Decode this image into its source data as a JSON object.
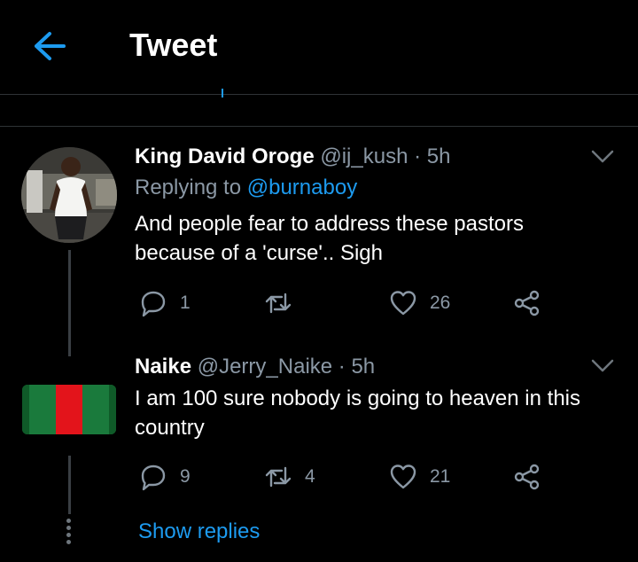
{
  "header": {
    "title": "Tweet"
  },
  "tweets": [
    {
      "name": "King David Oroge",
      "handle": "@ij_kush",
      "time": "· 5h",
      "replying_prefix": "Replying to",
      "replying_to": "@burnaboy",
      "text_line1": "And people fear to address these pastors",
      "text_line2": "because of a 'curse'.. Sigh",
      "replies": "1",
      "retweets": "",
      "likes": "26"
    },
    {
      "name": "Naike",
      "handle": "@Jerry_Naike",
      "time": "· 5h",
      "text_line1": "I am 100 sure nobody is going to heaven in this",
      "text_line2": "country",
      "replies": "9",
      "retweets": "4",
      "likes": "21"
    }
  ],
  "show_replies": "Show replies",
  "colors": {
    "accent": "#1d9bf0",
    "background": "#000000",
    "muted": "#8b98a5"
  },
  "icons": [
    "back-arrow-icon",
    "chevron-down-icon",
    "reply-icon",
    "retweet-icon",
    "like-icon",
    "share-icon"
  ]
}
